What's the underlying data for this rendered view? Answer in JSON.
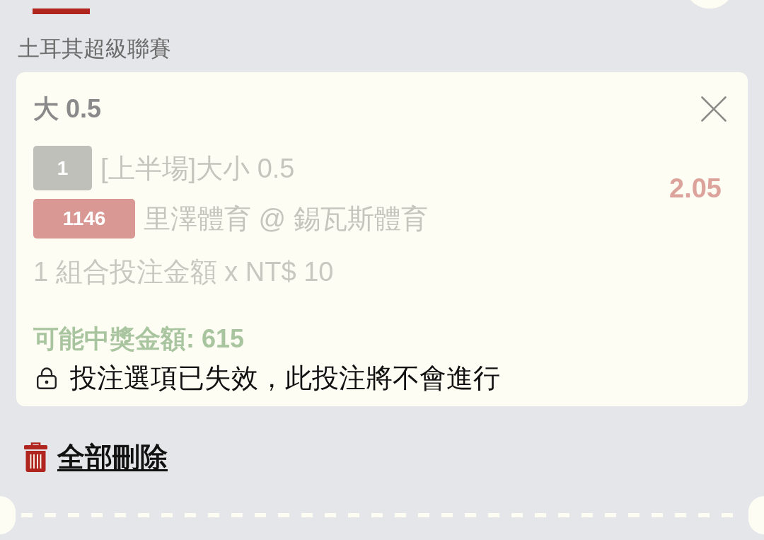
{
  "header": {
    "league": "土耳其超級聯賽"
  },
  "bet": {
    "title": "大 0.5",
    "expired": true,
    "odds": "2.05",
    "lines": [
      {
        "kind": "market",
        "badge": "1",
        "text": "[上半場]大小 0.5"
      },
      {
        "kind": "match",
        "badge": "1146",
        "text": "里澤體育 @ 錫瓦斯體育"
      }
    ],
    "stake": "1 組合投注金額 x NT$ 10",
    "potential_win": "可能中獎金額: 615",
    "notice": "投注選項已失效，此投注將不會進行"
  },
  "actions": {
    "delete_all": "全部刪除"
  }
}
